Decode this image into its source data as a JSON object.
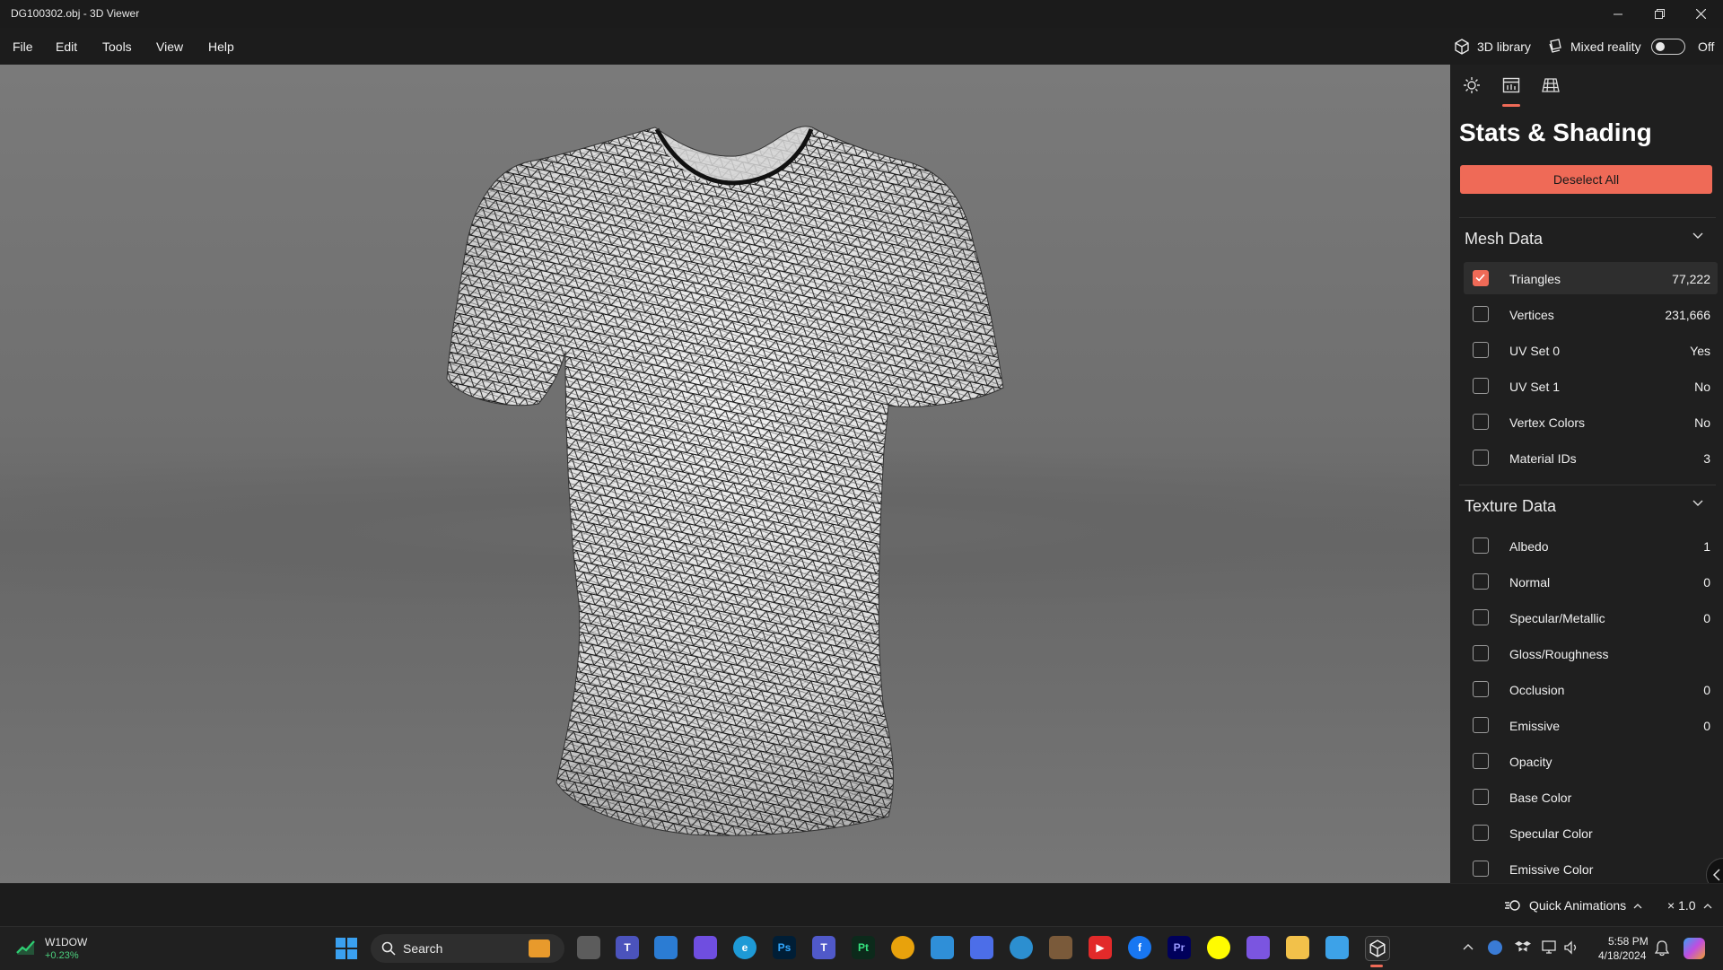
{
  "window": {
    "title": "DG100302.obj - 3D Viewer"
  },
  "menu": {
    "items": [
      "File",
      "Edit",
      "Tools",
      "View",
      "Help"
    ]
  },
  "topbar": {
    "library_label": "3D library",
    "mixed_reality_label": "Mixed reality",
    "mixed_reality_state": "Off"
  },
  "panel": {
    "title": "Stats & Shading",
    "deselect_label": "Deselect All",
    "mesh_section": "Mesh Data",
    "mesh_rows": [
      {
        "name": "Triangles",
        "value": "77,222",
        "checked": true
      },
      {
        "name": "Vertices",
        "value": "231,666",
        "checked": false
      },
      {
        "name": "UV Set 0",
        "value": "Yes",
        "checked": false
      },
      {
        "name": "UV Set 1",
        "value": "No",
        "checked": false
      },
      {
        "name": "Vertex Colors",
        "value": "No",
        "checked": false
      },
      {
        "name": "Material IDs",
        "value": "3",
        "checked": false
      }
    ],
    "texture_section": "Texture Data",
    "texture_rows": [
      {
        "name": "Albedo",
        "value": "1",
        "checked": false
      },
      {
        "name": "Normal",
        "value": "0",
        "checked": false
      },
      {
        "name": "Specular/Metallic",
        "value": "0",
        "checked": false
      },
      {
        "name": "Gloss/Roughness",
        "value": "",
        "checked": false
      },
      {
        "name": "Occlusion",
        "value": "0",
        "checked": false
      },
      {
        "name": "Emissive",
        "value": "0",
        "checked": false
      },
      {
        "name": "Opacity",
        "value": "",
        "checked": false
      },
      {
        "name": "Base Color",
        "value": "",
        "checked": false
      },
      {
        "name": "Specular Color",
        "value": "",
        "checked": false
      },
      {
        "name": "Emissive Color",
        "value": "",
        "checked": false
      }
    ]
  },
  "status": {
    "quick_animations": "Quick Animations",
    "speed": "× 1.0"
  },
  "taskbar": {
    "search_label": "Search",
    "stock_name": "W1DOW",
    "stock_change": "+0.23%",
    "time": "5:58 PM",
    "date": "4/18/2024",
    "apps": [
      {
        "label": "",
        "color": "#5c5c5c"
      },
      {
        "label": "T",
        "color": "#4b53bc"
      },
      {
        "label": "",
        "color": "#2b7cd3"
      },
      {
        "label": "",
        "color": "#6f4ee0"
      },
      {
        "label": "e",
        "color": "#1e9ad6"
      },
      {
        "label": "Ps",
        "color": "#001e36"
      },
      {
        "label": "T",
        "color": "#5059c9"
      },
      {
        "label": "Pt",
        "color": "#0c2a1b"
      },
      {
        "label": "",
        "color": "#e8a20c"
      },
      {
        "label": "",
        "color": "#2f8fd8"
      },
      {
        "label": "",
        "color": "#4c6ee8"
      },
      {
        "label": "",
        "color": "#2c8fd0"
      },
      {
        "label": "",
        "color": "#7a5a3a"
      },
      {
        "label": "▶",
        "color": "#e22a2a"
      },
      {
        "label": "f",
        "color": "#1877f2"
      },
      {
        "label": "Pr",
        "color": "#00005b"
      },
      {
        "label": "",
        "color": "#fffc00"
      },
      {
        "label": "",
        "color": "#7b55e0"
      },
      {
        "label": "",
        "color": "#f2c14a"
      },
      {
        "label": "",
        "color": "#3da2e8"
      },
      {
        "label": "",
        "color": "#2a2a2a"
      }
    ]
  },
  "colors": {
    "accent": "#ef6a57",
    "panel_bg": "#1f1f1f",
    "viewport_bg": "#6f6f6f"
  }
}
